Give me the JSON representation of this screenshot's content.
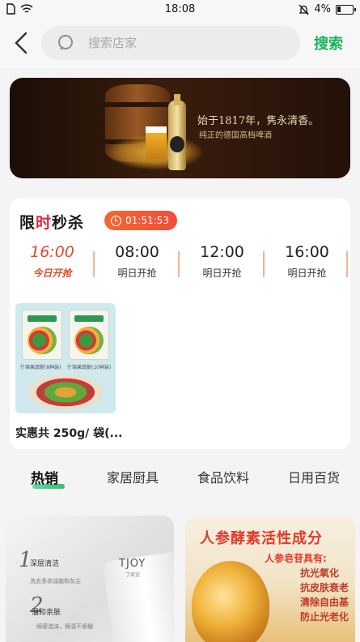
{
  "status_bar": {
    "time": "18:08",
    "battery": "4%"
  },
  "header": {
    "search_placeholder": "搜索店家",
    "search_button": "搜索"
  },
  "banner": {
    "brand": "",
    "slogan": "始于1817年，隽永清香。",
    "subtitle": "纯正的德国高档啤酒"
  },
  "flash_sale": {
    "title_part1": "限",
    "title_part2": "时",
    "title_part3": "秒杀",
    "countdown": "01:51:53",
    "slots": [
      {
        "time": "16:00",
        "label": "今日开抢",
        "active": true
      },
      {
        "time": "08:00",
        "label": "明日开抢",
        "active": false
      },
      {
        "time": "12:00",
        "label": "明日开抢",
        "active": false
      },
      {
        "time": "16:00",
        "label": "明日开抢",
        "active": false
      }
    ],
    "product": {
      "title": "实惠共 250g/ 袋(...",
      "bag1_caption": "什锦果蔬脆(8种装)",
      "bag2_caption": "什锦果蔬脆(10种装)"
    }
  },
  "category_tabs": [
    "热销",
    "家居厨具",
    "食品饮料",
    "日用百货"
  ],
  "products": [
    {
      "step1_num": "1",
      "step1_title": "深层清洁",
      "step1_desc": "洗去多余油脂和灰尘",
      "step2_num": "2",
      "step2_title": "温和亲肤",
      "step2_desc": "绵密泡沫，保湿不紧绷",
      "brand": "TJOY",
      "brand_sub": "丁家宜"
    },
    {
      "headline": "人参酵素活性成分",
      "sub_headline": "人参皂苷具有:",
      "benefits": [
        "抗光氧化",
        "抗皮肤衰老",
        "清除自由基",
        "防止光老化"
      ]
    }
  ]
}
